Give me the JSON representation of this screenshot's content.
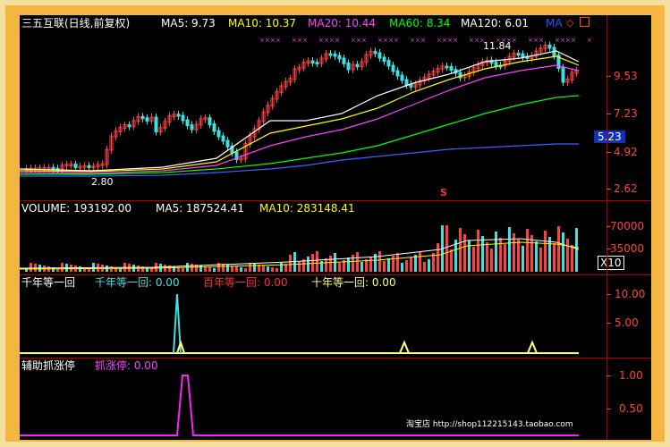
{
  "header": {
    "stock_title": "三五互联(日线,前复权)",
    "ma5": "MA5: 9.73",
    "ma10": "MA10: 10.37",
    "ma20": "MA20: 10.44",
    "ma60": "MA60: 8.34",
    "ma120": "MA120: 6.01",
    "ma_button": "MA",
    "icons": [
      "diamond-icon",
      "square-icon"
    ]
  },
  "price_panel": {
    "y_labels": [
      "9.53",
      "7.23",
      "5.23",
      "4.92",
      "2.62"
    ],
    "high_marker": "11.84",
    "low_marker": "2.80",
    "signal_marker": "S"
  },
  "volume_panel": {
    "title": "VOLUME: 193192.00",
    "ma5": "MA5: 187524.41",
    "ma10": "MA10: 283148.41",
    "y_labels": [
      "70000",
      "35000"
    ],
    "unit": "X10"
  },
  "indicator1": {
    "title": "千年等一回",
    "field1": "千年等一回: 0.00",
    "field2": "百年等一回: 0.00",
    "field3": "十年等一回: 0.00",
    "y_labels": [
      "10.00",
      "5.00"
    ]
  },
  "indicator2": {
    "title": "辅助抓涨停",
    "field1": "抓涨停: 0.00",
    "y_labels": [
      "1.00",
      "0.50"
    ],
    "watermark": "淘宝店  http://shop112215143.taobao.com"
  },
  "colors": {
    "ma5": "#ffffff",
    "ma10": "#ffff00",
    "ma20": "#ff40ff",
    "ma60": "#00ff00",
    "ma120": "#4060ff",
    "up": "#ff4040",
    "down": "#40e0e0",
    "axis": "#b00000",
    "border": "#f3b640"
  }
}
